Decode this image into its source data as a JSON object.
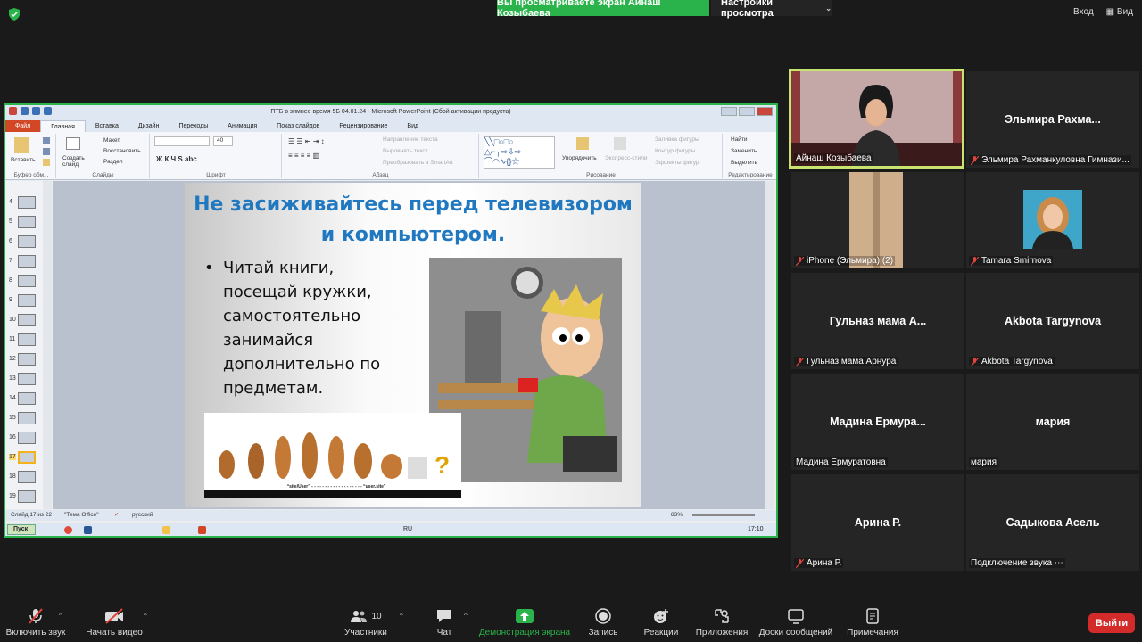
{
  "topbar": {
    "banner": "Вы просматриваете экран Айнаш Козыбаева",
    "view_settings": "Настройки просмотра",
    "enter": "Вход",
    "view": "Вид"
  },
  "ppt": {
    "window_title": "ПТБ в зимнее время 5Б 04.01.24 - Microsoft PowerPoint (Сбой активации продукта)",
    "tabs": [
      "Файл",
      "Главная",
      "Вставка",
      "Дизайн",
      "Переходы",
      "Анимация",
      "Показ слайдов",
      "Рецензирование",
      "Вид"
    ],
    "ribbon": {
      "paste": "Вставить",
      "clipboard": "Буфер обм...",
      "layout": "Макет",
      "restore": "Восстановить",
      "new_slide": "Создать слайд",
      "section": "Раздел",
      "slides_group": "Слайды",
      "font_group": "Шрифт",
      "font_size": "40",
      "paragraph_group": "Абзац",
      "text_direction": "Направление текста",
      "align_text": "Выровнять текст",
      "smartart": "Преобразовать в SmartArt",
      "arrange": "Упорядочить",
      "quick_styles": "Экспресс-стили",
      "shape_fill": "Заливка фигуры",
      "shape_outline": "Контур фигуры",
      "shape_effects": "Эффекты фигур",
      "drawing_group": "Рисование",
      "find": "Найти",
      "replace": "Заменить",
      "select": "Выделить",
      "editing_group": "Редактирование"
    },
    "thumbs": [
      "4",
      "5",
      "6",
      "7",
      "8",
      "9",
      "10",
      "11",
      "12",
      "13",
      "14",
      "15",
      "16",
      "17",
      "18",
      "19"
    ],
    "slide": {
      "title": "Не засиживайтесь перед телевизором и компьютером.",
      "bullet": "Читай книги, посещай  кружки, самостоятельно занимайся дополнительно по предметам.",
      "evolution_caption": "“site/User” - - - - - - - - - - - - - - - - - - - “user.site”"
    },
    "status": {
      "slide_counter": "Слайд 17 из 22",
      "theme": "\"Тема Office\"",
      "language": "русский",
      "zoom": "83%"
    },
    "taskbar": {
      "start": "Пуск",
      "lang": "RU",
      "clock": "17:10"
    }
  },
  "participants": [
    {
      "name": "Айнаш Козыбаева",
      "big": "",
      "muted": false
    },
    {
      "name": "Эльмира Рахманкуловна Гимнази...",
      "big": "Эльмира  Рахма...",
      "muted": true
    },
    {
      "name": "iPhone (Эльмира) (2)",
      "big": "",
      "muted": true
    },
    {
      "name": "Tamara Smirnova",
      "big": "",
      "muted": true
    },
    {
      "name": "Гульназ мама Арнура",
      "big": "Гульназ мама  А...",
      "muted": true
    },
    {
      "name": "Akbota Targynova",
      "big": "Akbota Targynova",
      "muted": true
    },
    {
      "name": "Мадина Ермуратовна",
      "big": "Мадина  Ермура...",
      "muted": false
    },
    {
      "name": "мария",
      "big": "мария",
      "muted": false
    },
    {
      "name": "Арина Р.",
      "big": "Арина Р.",
      "muted": true
    },
    {
      "name": "Подключение звука ⋯",
      "big": "Садыкова Асель",
      "muted": false
    }
  ],
  "toolbar": {
    "unmute": "Включить звук",
    "start_video": "Начать видео",
    "participants": "Участники",
    "participants_count": "10",
    "chat": "Чат",
    "share": "Демонстрация экрана",
    "record": "Запись",
    "reactions": "Реакции",
    "apps": "Приложения",
    "whiteboards": "Доски сообщений",
    "notes": "Примечания",
    "leave": "Выйти"
  },
  "colors": {
    "accent_green": "#2ab34a",
    "leave_red": "#d32a2a",
    "slide_title_blue": "#1f78c0",
    "mute_red": "#e0453d"
  }
}
